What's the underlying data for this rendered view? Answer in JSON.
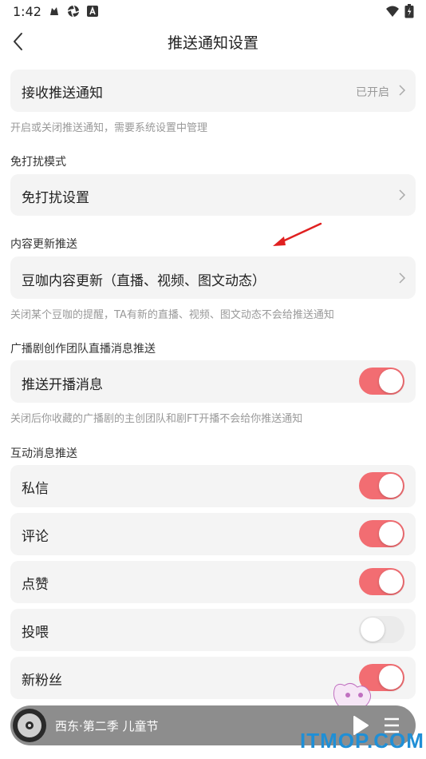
{
  "status_bar": {
    "time": "1:42",
    "icons": [
      "notification-icon",
      "app-icon",
      "a-icon"
    ],
    "right_icons": [
      "wifi-icon",
      "battery-icon"
    ]
  },
  "nav": {
    "title": "推送通知设置",
    "back_icon": "chevron-left-icon"
  },
  "receive": {
    "label": "接收推送通知",
    "value": "已开启",
    "hint": "开启或关闭推送通知，需要系统设置中管理"
  },
  "dnd": {
    "section": "免打扰模式",
    "label": "免打扰设置"
  },
  "content_update": {
    "section": "内容更新推送",
    "label": "豆咖内容更新（直播、视频、图文动态）",
    "hint": "关闭某个豆咖的提醒，TA有新的直播、视频、图文动态不会给推送通知"
  },
  "radio_drama": {
    "section": "广播剧创作团队直播消息推送",
    "label": "推送开播消息",
    "enabled": true,
    "hint": "关闭后你收藏的广播剧的主创团队和剧FT开播不会给你推送通知"
  },
  "interaction": {
    "section": "互动消息推送",
    "items": [
      {
        "label": "私信",
        "enabled": true
      },
      {
        "label": "评论",
        "enabled": true
      },
      {
        "label": "点赞",
        "enabled": true
      },
      {
        "label": "投喂",
        "enabled": false
      },
      {
        "label": "新粉丝",
        "enabled": true
      }
    ]
  },
  "player": {
    "title": "西东·第二季 儿童节",
    "play_icon": "play-icon",
    "list_icon": "playlist-icon"
  },
  "watermark": "ITMOP.COM",
  "colors": {
    "accent": "#f26d72",
    "card_bg": "#f4f4f4",
    "hint_text": "#999999",
    "annotation_arrow": "#e02020",
    "watermark": "#1f8fd6"
  }
}
